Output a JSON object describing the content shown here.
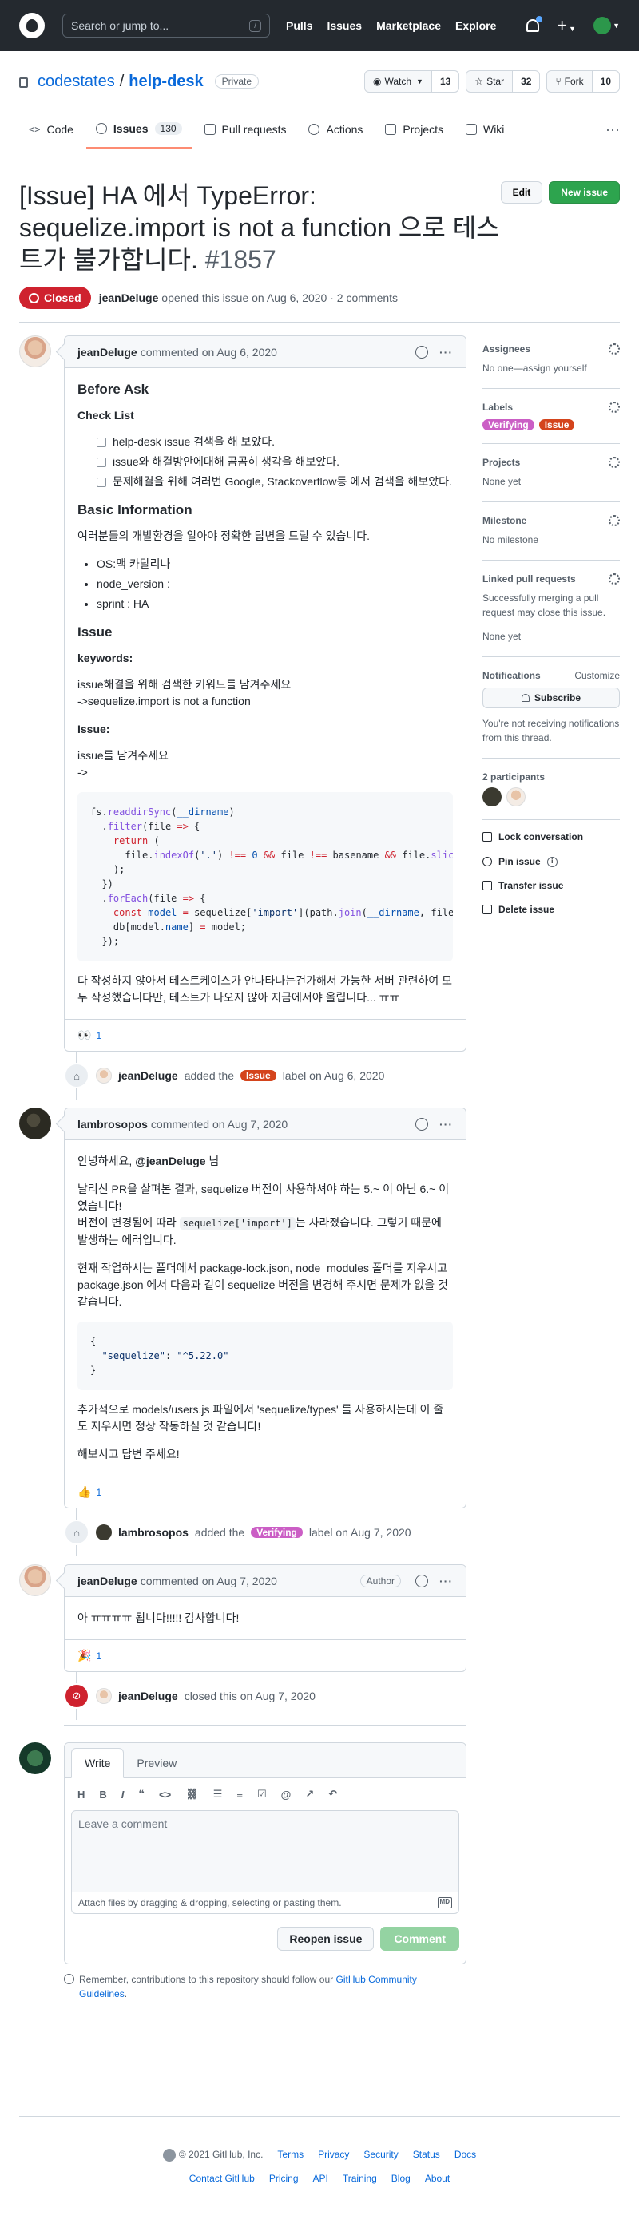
{
  "nav": {
    "search_placeholder": "Search or jump to...",
    "slash": "/",
    "links": [
      "Pulls",
      "Issues",
      "Marketplace",
      "Explore"
    ]
  },
  "repo": {
    "owner": "codestates",
    "sep": "/",
    "name": "help-desk",
    "visibility": "Private",
    "watch_label": "Watch",
    "watch_count": "13",
    "star_label": "Star",
    "star_count": "32",
    "fork_label": "Fork",
    "fork_count": "10"
  },
  "tabs": [
    {
      "label": "Code"
    },
    {
      "label": "Issues",
      "count": "130"
    },
    {
      "label": "Pull requests"
    },
    {
      "label": "Actions"
    },
    {
      "label": "Projects"
    },
    {
      "label": "Wiki"
    }
  ],
  "issue": {
    "title": "[Issue] HA 에서 TypeError: sequelize.import is not a function 으로 테스트가 불가합니다.",
    "number": "#1857",
    "state": "Closed",
    "edit_label": "Edit",
    "new_label": "New issue",
    "author": "jeanDeluge",
    "meta_text": "opened this issue on Aug 6, 2020 · 2 comments"
  },
  "comment1": {
    "author": "jeanDeluge",
    "meta": "commented on Aug 6, 2020",
    "h_before": "Before Ask",
    "h_checklist": "Check List",
    "checks": [
      "help-desk issue 검색을 해 보았다.",
      "issue와 해결방안에대해 곰곰히 생각을 해보았다.",
      "문제해결을 위해 여러번 Google, Stackoverflow등 에서 검색을 해보았다."
    ],
    "h_basic": "Basic Information",
    "basic_text": "여러분들의 개발환경을 알아야 정확한 답변을 드릴 수 있습니다.",
    "env": [
      "OS:맥 카탈리나",
      "node_version :",
      "sprint : HA"
    ],
    "h_issue": "Issue",
    "h_keywords": "keywords:",
    "kw_text1": "issue해결을 위해 검색한 키워드를 남겨주세요",
    "kw_text2": "->sequelize.import is not a function",
    "h_issue2": "Issue:",
    "issue_text1": "issue를 남겨주세요",
    "issue_text2": "->",
    "closing": "다 작성하지 않아서 테스트케이스가 안나타나는건가해서 가능한 서버 관련하여 모두 작성했습니다만, 테스트가 나오지 않아 지금에서야 올립니다... ㅠㅠ",
    "reaction_emoji": "👀",
    "reaction_count": "1"
  },
  "event1": {
    "actor": "jeanDeluge",
    "pre": "added the",
    "label": "Issue",
    "post": "label on Aug 6, 2020"
  },
  "comment2": {
    "author": "lambrosopos",
    "meta": "commented on Aug 7, 2020",
    "greet_pre": "안녕하세요,",
    "mention": "@jeanDeluge",
    "greet_post": "님",
    "p1a": "날리신 PR을 살펴본 결과, sequelize 버전이 사용하셔야 하는 5.~ 이 아닌 6.~ 이였습니다!",
    "p1b": "버전이 변경됨에 따라",
    "p1code": "sequelize['import']",
    "p1c": "는 사라졌습니다. 그렇기 때문에 발생하는 에러입니다.",
    "p2": "현재 작업하시는 폴더에서 package-lock.json, node_modules 폴더를 지우시고 package.json 에서 다음과 같이 sequelize 버전을 변경해 주시면 문제가 없을 것 같습니다.",
    "p3": "추가적으로 models/users.js 파일에서 'sequelize/types' 를 사용하시는데 이 줄도 지우시면 정상 작동하실 것 같습니다!",
    "p4": "해보시고 답변 주세요!",
    "reaction_emoji": "👍",
    "reaction_count": "1"
  },
  "event2": {
    "actor": "lambrosopos",
    "pre": "added the",
    "label": "Verifying",
    "post": "label on Aug 7, 2020"
  },
  "comment3": {
    "author": "jeanDeluge",
    "meta": "commented on Aug 7, 2020",
    "badge": "Author",
    "body": "아 ㅠㅠㅠㅠ 됩니다!!!!! 감사합니다!",
    "reaction_emoji": "🎉",
    "reaction_count": "1"
  },
  "event3": {
    "actor": "jeanDeluge",
    "post": "closed this on Aug 7, 2020"
  },
  "editor": {
    "tab_write": "Write",
    "tab_preview": "Preview",
    "placeholder": "Leave a comment",
    "attach": "Attach files by dragging & dropping, selecting or pasting them.",
    "md": "MD",
    "reopen": "Reopen issue",
    "submit": "Comment",
    "note_pre": "Remember, contributions to this repository should follow our",
    "note_link": "GitHub Community Guidelines",
    "note_post": "."
  },
  "sidebar": {
    "assignees_h": "Assignees",
    "assignees_v": "No one—assign yourself",
    "labels_h": "Labels",
    "label1": "Verifying",
    "label2": "Issue",
    "projects_h": "Projects",
    "projects_v": "None yet",
    "milestone_h": "Milestone",
    "milestone_v": "No milestone",
    "linked_h": "Linked pull requests",
    "linked_desc": "Successfully merging a pull request may close this issue.",
    "linked_v": "None yet",
    "notif_h": "Notifications",
    "notif_customize": "Customize",
    "subscribe": "Subscribe",
    "notif_desc": "You're not receiving notifications from this thread.",
    "participants_h": "2 participants",
    "lock": "Lock conversation",
    "pin": "Pin issue",
    "transfer": "Transfer issue",
    "delete": "Delete issue"
  },
  "footer": {
    "copy": "© 2021 GitHub, Inc.",
    "row1": [
      "Terms",
      "Privacy",
      "Security",
      "Status",
      "Docs"
    ],
    "row2": [
      "Contact GitHub",
      "Pricing",
      "API",
      "Training",
      "Blog",
      "About"
    ]
  },
  "colors": {
    "closed": "#cf222e",
    "label_issue": "#d4441c",
    "label_verifying": "#cb5ec5",
    "primary": "#2da44e"
  }
}
